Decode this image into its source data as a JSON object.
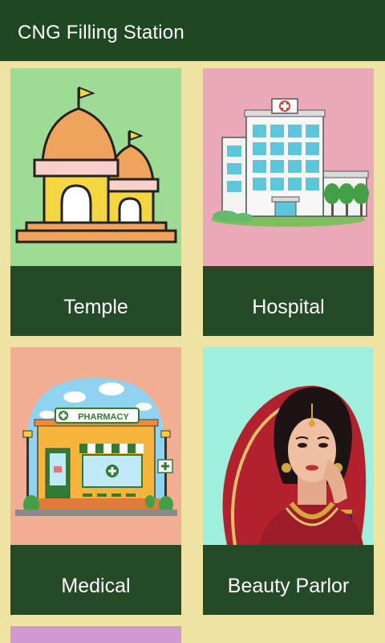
{
  "appbar": {
    "title": "CNG Filling Station"
  },
  "colors": {
    "appbar": "#1f4722",
    "page_background": "#efe3a4",
    "label_bar": "#244a28",
    "temple_bg": "#9edc96",
    "hospital_bg": "#eba8b8",
    "medical_bg": "#f1ae93",
    "beauty_bg": "#9ef0dc",
    "partial_card_bg": "#cf9ad2"
  },
  "cards": [
    {
      "label": "Temple",
      "icon": "temple-icon"
    },
    {
      "label": "Hospital",
      "icon": "hospital-icon"
    },
    {
      "label": "Medical",
      "icon": "pharmacy-icon",
      "sign_text": "PHARMACY"
    },
    {
      "label": "Beauty Parlor",
      "icon": "bride-portrait"
    }
  ]
}
